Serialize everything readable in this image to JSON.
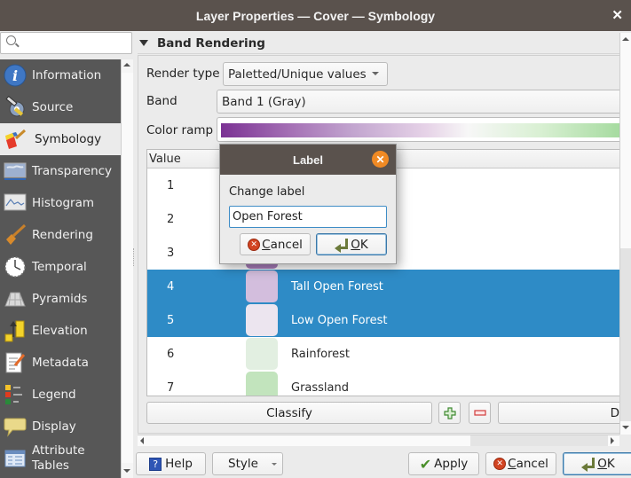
{
  "window": {
    "title": "Layer Properties — Cover — Symbology",
    "close_glyph": "✕"
  },
  "sidebar": {
    "search_placeholder": "",
    "items": [
      {
        "label": "Information",
        "icon": "info-icon"
      },
      {
        "label": "Source",
        "icon": "source-icon"
      },
      {
        "label": "Symbology",
        "icon": "symbology-brush-icon",
        "active": true
      },
      {
        "label": "Transparency",
        "icon": "transparency-icon"
      },
      {
        "label": "Histogram",
        "icon": "histogram-icon"
      },
      {
        "label": "Rendering",
        "icon": "rendering-brush-icon"
      },
      {
        "label": "Temporal",
        "icon": "clock-icon"
      },
      {
        "label": "Pyramids",
        "icon": "pyramids-icon"
      },
      {
        "label": "Elevation",
        "icon": "elevation-icon"
      },
      {
        "label": "Metadata",
        "icon": "metadata-icon"
      },
      {
        "label": "Legend",
        "icon": "legend-icon"
      },
      {
        "label": "Display",
        "icon": "display-bubble-icon"
      },
      {
        "label": "Attribute Tables",
        "icon": "attribute-table-icon"
      }
    ]
  },
  "main": {
    "section_title": "Band Rendering",
    "render_type_label": "Render type",
    "render_type_value": "Paletted/Unique values",
    "band_label": "Band",
    "band_value": "Band 1 (Gray)",
    "color_ramp_label": "Color ramp",
    "table": {
      "column_value": "Value",
      "rows": [
        {
          "value": "1",
          "color": "#7b3294",
          "label": "",
          "selected": false
        },
        {
          "value": "2",
          "color": "#9461a8",
          "label": "",
          "selected": false
        },
        {
          "value": "3",
          "color": "#a87dbb",
          "label": "",
          "selected": false
        },
        {
          "value": "4",
          "color": "#d3bedd",
          "label": "Tall Open Forest",
          "selected": true
        },
        {
          "value": "5",
          "color": "#ece5ef",
          "label": "Low Open Forest",
          "selected": true
        },
        {
          "value": "6",
          "color": "#e2efe1",
          "label": "Rainforest",
          "selected": false
        },
        {
          "value": "7",
          "color": "#c2e4bd",
          "label": "Grassland",
          "selected": false
        }
      ]
    },
    "classify_label": "Classify",
    "add_icon": "plus-icon",
    "remove_icon": "minus-icon",
    "truncated_button_label": "D"
  },
  "footer": {
    "help": "Help",
    "style": "Style",
    "apply": "Apply",
    "cancel_pre": "",
    "cancel_u": "C",
    "cancel_rest": "ancel",
    "ok_u": "O",
    "ok_rest": "K"
  },
  "dialog": {
    "title": "Label",
    "prompt": "Change label",
    "input_value": "Open Forest",
    "cancel_u": "C",
    "cancel_rest": "ancel",
    "ok_u": "O",
    "ok_rest": "K"
  }
}
